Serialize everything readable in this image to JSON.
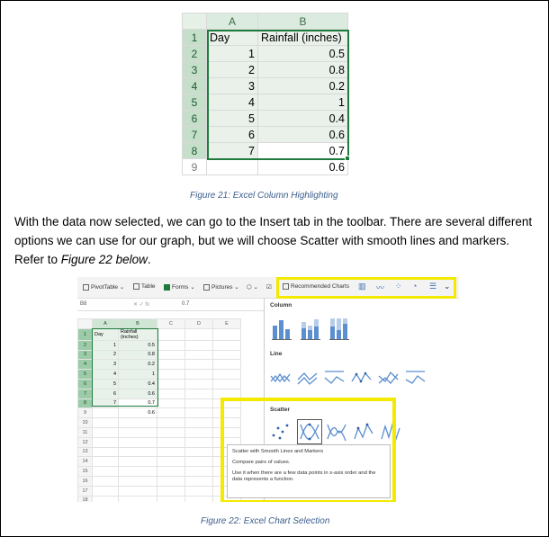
{
  "figure21": {
    "columns": [
      "A",
      "B"
    ],
    "rows": [
      {
        "row": "1",
        "a": "Day",
        "b": "Rainfall (inches)"
      },
      {
        "row": "2",
        "a": "1",
        "b": "0.5"
      },
      {
        "row": "3",
        "a": "2",
        "b": "0.8"
      },
      {
        "row": "4",
        "a": "3",
        "b": "0.2"
      },
      {
        "row": "5",
        "a": "4",
        "b": "1"
      },
      {
        "row": "6",
        "a": "5",
        "b": "0.4"
      },
      {
        "row": "7",
        "a": "6",
        "b": "0.6"
      },
      {
        "row": "8",
        "a": "7",
        "b": "0.7"
      },
      {
        "row": "9",
        "a": "",
        "b": "0.6"
      }
    ],
    "caption": "Figure 21: Excel Column Highlighting"
  },
  "paragraph": {
    "text_before": "With the data now selected, we can go to the Insert tab in the toolbar. There are several different options we can use for our graph, but we will choose Scatter with smooth lines and markers.  Refer to ",
    "emphasis": "Figure 22 below",
    "text_after": "."
  },
  "figure22": {
    "toolbar": {
      "pivottable": "PivotTable",
      "table": "Table",
      "forms": "Forms",
      "pictures": "Pictures",
      "recommended": "Recommended Charts"
    },
    "formula_bar": {
      "cell": "B8",
      "value": "0.7"
    },
    "mini_columns": [
      "A",
      "B",
      "C",
      "D",
      "E"
    ],
    "mini_rows": [
      {
        "row": "1",
        "a": "Day",
        "b": "Rainfall (inches)"
      },
      {
        "row": "2",
        "a": "1",
        "b": "0.5"
      },
      {
        "row": "3",
        "a": "2",
        "b": "0.8"
      },
      {
        "row": "4",
        "a": "3",
        "b": "0.2"
      },
      {
        "row": "5",
        "a": "4",
        "b": "1"
      },
      {
        "row": "6",
        "a": "5",
        "b": "0.4"
      },
      {
        "row": "7",
        "a": "6",
        "b": "0.6"
      },
      {
        "row": "8",
        "a": "7",
        "b": "0.7"
      },
      {
        "row": "9",
        "a": "",
        "b": "0.6"
      },
      {
        "row": "10",
        "a": "",
        "b": ""
      },
      {
        "row": "11",
        "a": "",
        "b": ""
      },
      {
        "row": "12",
        "a": "",
        "b": ""
      },
      {
        "row": "13",
        "a": "",
        "b": ""
      },
      {
        "row": "14",
        "a": "",
        "b": ""
      },
      {
        "row": "15",
        "a": "",
        "b": ""
      },
      {
        "row": "16",
        "a": "",
        "b": ""
      },
      {
        "row": "17",
        "a": "",
        "b": ""
      },
      {
        "row": "18",
        "a": "",
        "b": ""
      }
    ],
    "panel": {
      "column_label": "Column",
      "line_label": "Line",
      "scatter_label": "Scatter"
    },
    "tooltip": {
      "title": "Scatter with Smooth Lines and Markers",
      "line1": "Compare pairs of values.",
      "line2": "Use it when there are a few data points in x-axis order and the data represents a function."
    },
    "caption": "Figure 22: Excel Chart Selection"
  },
  "colors": {
    "selection_green": "#1e7b3c",
    "highlight_yellow": "#f4ea00",
    "caption_blue": "#3b5d8c"
  }
}
